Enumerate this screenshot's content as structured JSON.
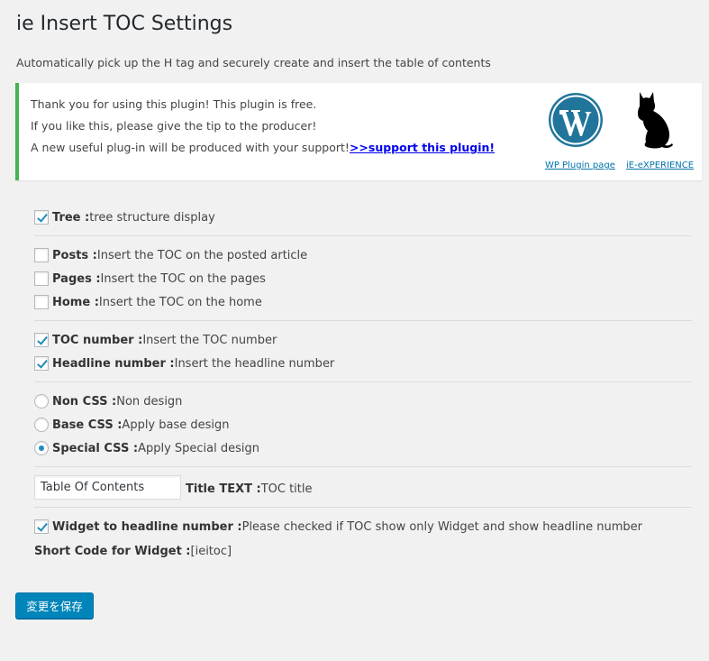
{
  "header": {
    "title": "ie Insert TOC Settings",
    "subtitle": "Automatically pick up the H tag and securely create and insert the table of contents"
  },
  "notice": {
    "line1": "Thank you for using this plugin! This plugin is free.",
    "line2": "If you like this, please give the tip to the producer!",
    "line3": "A new useful plug-in will be produced with your support!",
    "support_link": ">>support this plugin!",
    "wp_link": "WP Plugin page",
    "ie_link": "iE-eXPERIENCE",
    "accent_color": "#46b450"
  },
  "options": {
    "tree": {
      "label": "Tree :",
      "desc": " tree structure display",
      "checked": true
    },
    "posts": {
      "label": "Posts :",
      "desc": " Insert the TOC on the posted article",
      "checked": false
    },
    "pages": {
      "label": "Pages :",
      "desc": " Insert the TOC on the pages",
      "checked": false
    },
    "home": {
      "label": "Home :",
      "desc": " Insert the TOC on the home",
      "checked": false
    },
    "toc_number": {
      "label": "TOC number :",
      "desc": " Insert the TOC number",
      "checked": true
    },
    "headline_number": {
      "label": "Headline number :",
      "desc": " Insert the headline number",
      "checked": true
    },
    "non_css": {
      "label": "Non CSS :",
      "desc": " Non design",
      "selected": false
    },
    "base_css": {
      "label": "Base CSS :",
      "desc": " Apply base design",
      "selected": false
    },
    "special_css": {
      "label": "Special CSS :",
      "desc": " Apply Special design",
      "selected": true
    },
    "title_text": {
      "value": "Table Of Contents",
      "label": "Title TEXT :",
      "desc": " TOC title"
    },
    "widget": {
      "label": "Widget to headline number :",
      "desc": " Please checked if TOC show only Widget and show headline number",
      "checked": true
    },
    "shortcode": {
      "label": "Short Code for Widget :",
      "value": " [ieitoc]"
    }
  },
  "save_button": {
    "label": "変更を保存",
    "color": "#0085ba"
  }
}
